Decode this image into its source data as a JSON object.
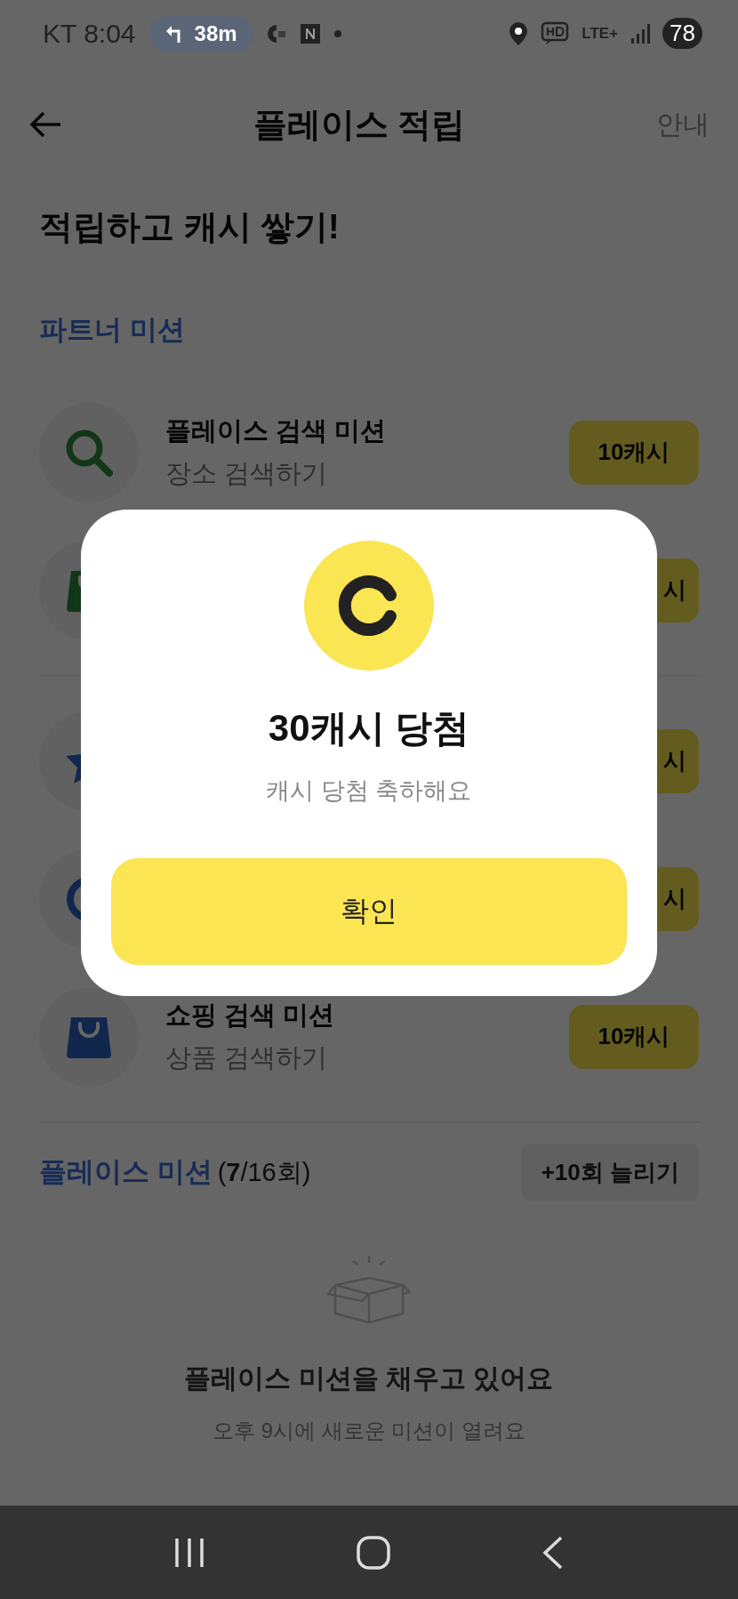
{
  "status_bar": {
    "carrier_time": "KT 8:04",
    "navigation_distance": "38m",
    "network": "LTE+",
    "battery": "78"
  },
  "header": {
    "title": "플레이스 적립",
    "guide_link": "안내"
  },
  "hero_title": "적립하고 캐시 쌓기!",
  "partner_section": {
    "title": "파트너 미션"
  },
  "mission_groups": [
    {
      "missions": [
        {
          "kind": "search",
          "title": "플레이스 검색 미션",
          "subtitle": "장소 검색하기",
          "reward": "10캐시"
        },
        {
          "kind": "bag",
          "reward": "시"
        }
      ]
    },
    {
      "missions": [
        {
          "kind": "star",
          "reward": "시"
        },
        {
          "kind": "ring",
          "reward": "시"
        },
        {
          "kind": "bag",
          "title": "쇼핑 검색 미션",
          "subtitle": "상품 검색하기",
          "reward": "10캐시"
        }
      ]
    }
  ],
  "place_section": {
    "title": "플레이스 미션",
    "count": "(**7**/16회)",
    "extend_button": "+10회 늘리기"
  },
  "empty_state": {
    "title": "플레이스 미션을 채우고 있어요",
    "subtitle": "오후 9시에 새로운 미션이 열려요"
  },
  "dialog": {
    "title": "30캐시 당첨",
    "message": "캐시 당첨 축하해요",
    "confirm_button": "확인"
  }
}
